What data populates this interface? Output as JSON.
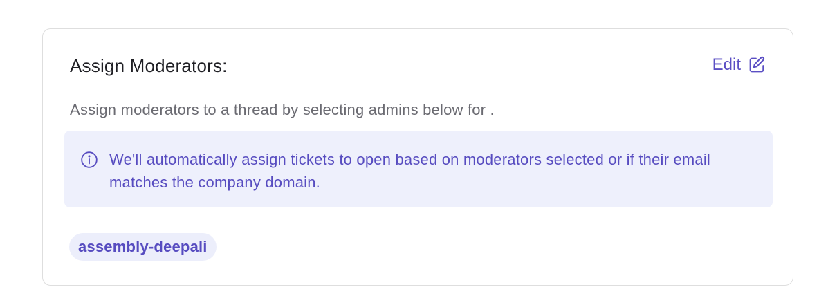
{
  "panel": {
    "title": "Assign Moderators:",
    "edit_label": "Edit",
    "edit_icon": "edit-square-pencil-icon",
    "description": "Assign moderators to a thread by selecting admins below for .",
    "info_icon": "info-circle-icon",
    "info_message": "We'll automatically assign tickets to open based on moderators selected or if their email matches the company domain.",
    "moderators": [
      "assembly-deepali"
    ]
  },
  "colors": {
    "accent": "#5b4fc4",
    "banner_bg": "#eef0fc",
    "chip_bg": "#eceefb",
    "border": "#dedede",
    "muted_text": "#6b6b72"
  }
}
